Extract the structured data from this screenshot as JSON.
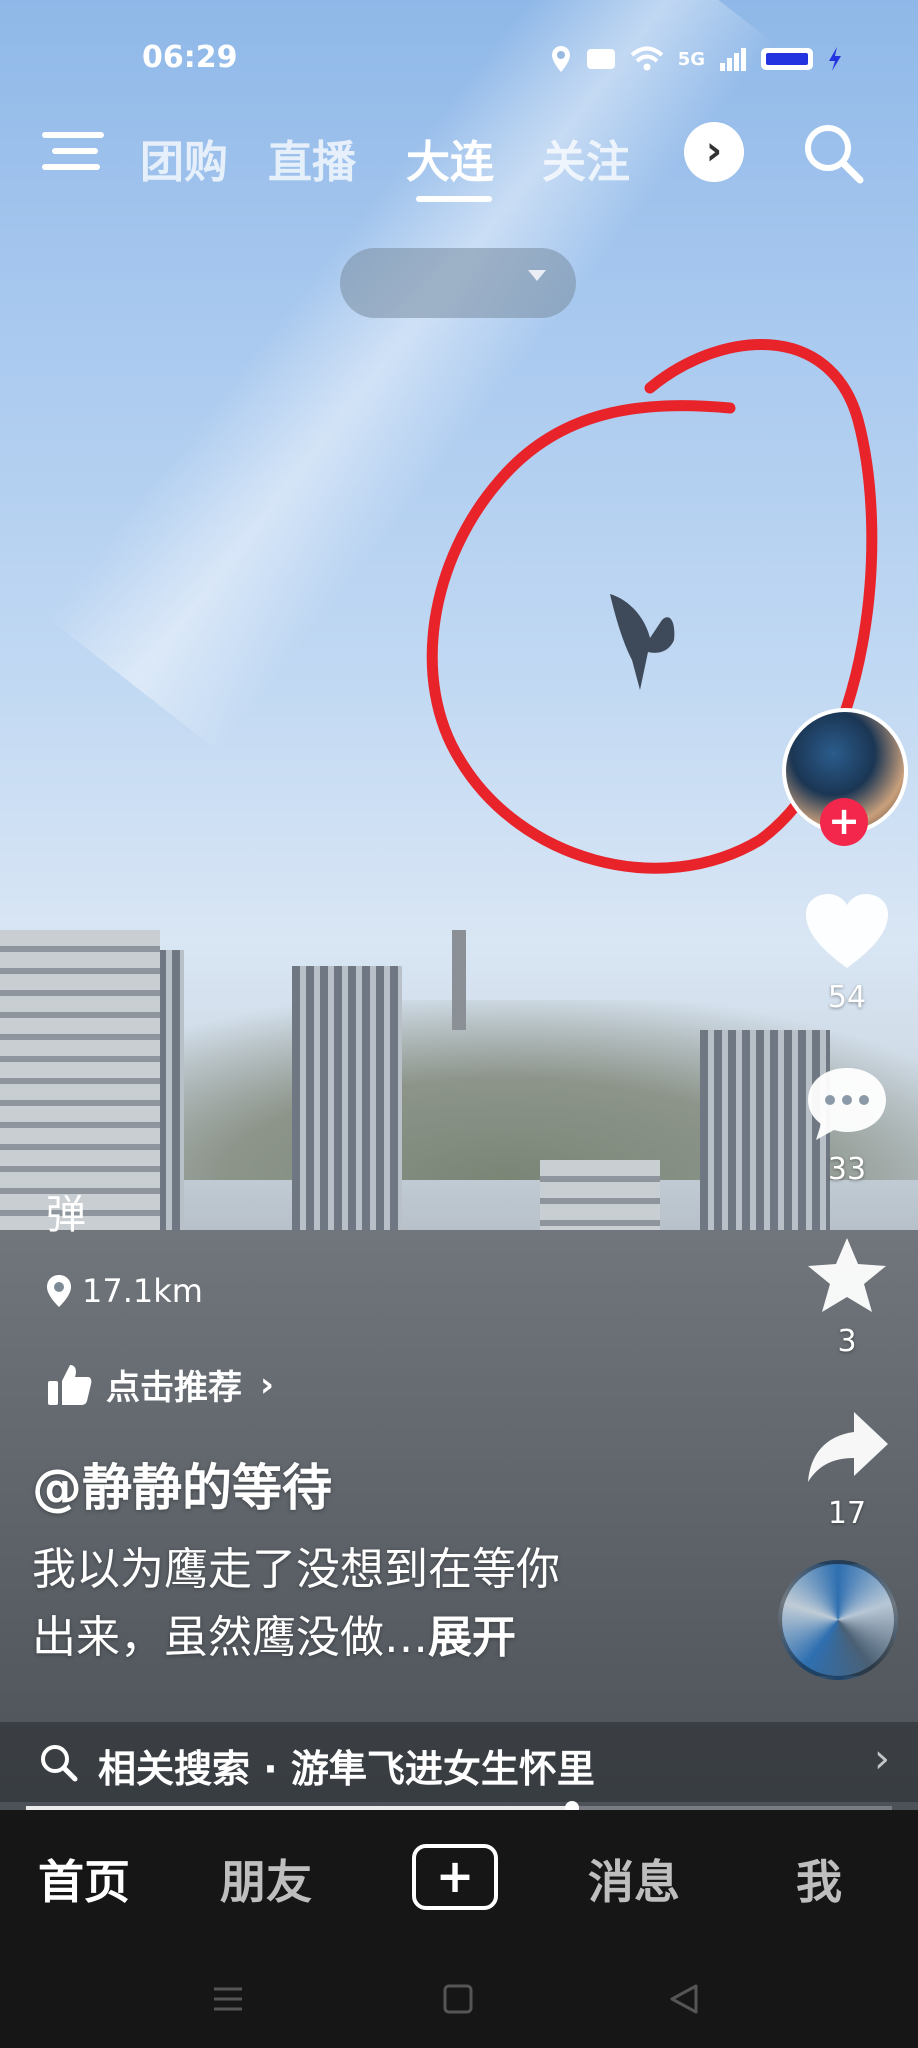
{
  "status_bar": {
    "time": "06:29",
    "network": "5G"
  },
  "top_nav": {
    "tabs": [
      "团购",
      "直播",
      "大连",
      "关注"
    ],
    "active_tab": "大连"
  },
  "location": {
    "distance": "17.1km"
  },
  "danmu_label": "弹",
  "recommend": {
    "label": "点击推荐"
  },
  "video": {
    "author": "@静静的等待",
    "description_line1": "我以为鹰走了没想到在等你",
    "description_line2": "出来，虽然鹰没做…",
    "expand_label": "展开",
    "progress": 0.63
  },
  "actions": {
    "likes": "54",
    "comments": "33",
    "favorites": "3",
    "shares": "17"
  },
  "related_search": {
    "text": "相关搜索 · 游隼飞进女生怀里"
  },
  "bottom_nav": {
    "items": [
      "首页",
      "朋友",
      "消息",
      "我"
    ],
    "active": "首页"
  },
  "colors": {
    "accent_red": "#f2274b",
    "annotation_red": "#e8242a"
  }
}
